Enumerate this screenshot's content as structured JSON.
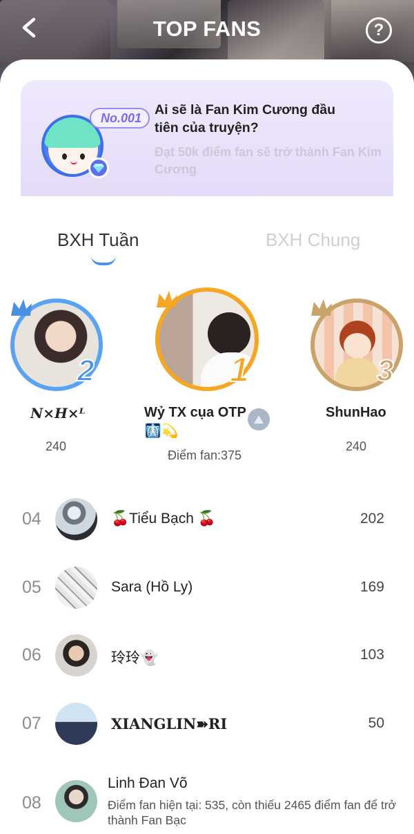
{
  "header": {
    "title": "TOP FANS",
    "help_symbol": "?"
  },
  "banner": {
    "badge": "No.001",
    "title": "Ai sẽ là Fan Kim Cương đầu tiên của truyện?",
    "subtitle": "Đạt 50k điểm fan sẽ trở thành Fan Kim Cương"
  },
  "tabs": [
    {
      "label": "BXH Tuần",
      "active": true
    },
    {
      "label": "BXH Chung",
      "active": false
    }
  ],
  "podium": {
    "first": {
      "rank": "1",
      "name": "Wỷ TX cụa OTP 🩻💫",
      "score_label": "Điểm fan:375"
    },
    "second": {
      "rank": "2",
      "name": "N×H×ᴸ",
      "score": "240"
    },
    "third": {
      "rank": "3",
      "name": "ShunHao",
      "score": "240"
    }
  },
  "list": [
    {
      "rank": "04",
      "name": "🍒Tiểu Bạch 🍒",
      "score": "202"
    },
    {
      "rank": "05",
      "name": "Sara (Hồ Ly)",
      "score": "169"
    },
    {
      "rank": "06",
      "name": "玲玲👻",
      "score": "103"
    },
    {
      "rank": "07",
      "name": "XIANGLIN➽RI",
      "score": "50"
    }
  ],
  "current_user": {
    "rank": "08",
    "name": "Linh Đan Võ",
    "status": "Điểm fan hiện tại: 535, còn thiếu 2465 điểm fan để trở thành Fan Bạc"
  },
  "colors": {
    "accent_blue": "#4a8ef0",
    "gold": "#f5a623",
    "bronze": "#c9a36a",
    "banner_bg": "#ebe4fb"
  }
}
